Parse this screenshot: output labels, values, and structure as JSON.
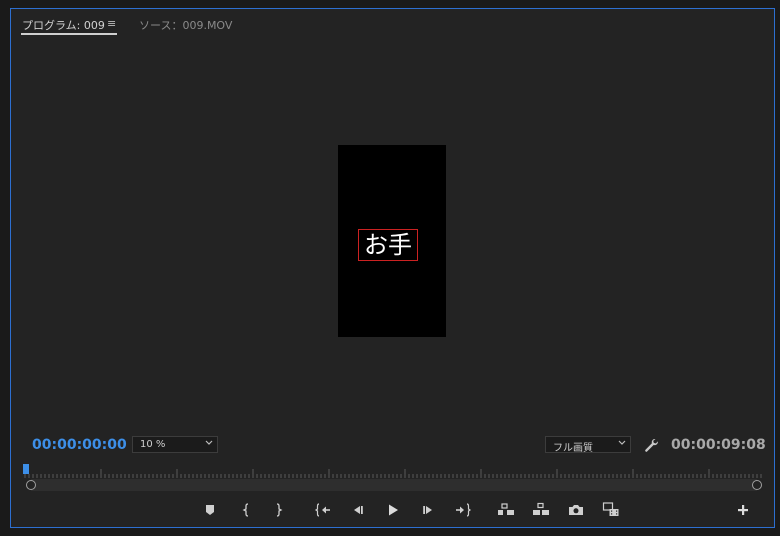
{
  "tabs": {
    "program": "プログラム: 009",
    "source": "ソース：009.MOV"
  },
  "viewer": {
    "caption": "お手"
  },
  "timecode": {
    "current": "00:00:00:00",
    "duration": "00:00:09:08"
  },
  "zoom": {
    "value": "10 %"
  },
  "quality": {
    "value": "フル画質"
  },
  "playhead": {
    "position": 0
  },
  "icons": [
    "menu-icon",
    "marker-icon",
    "mark-in-icon",
    "mark-out-icon",
    "go-to-in-icon",
    "step-back-icon",
    "play-icon",
    "step-forward-icon",
    "go-to-out-icon",
    "lift-icon",
    "extract-icon",
    "camera-icon",
    "compare-view-icon",
    "add-icon",
    "wrench-icon",
    "chevron-down-icon"
  ],
  "colors": {
    "accent": "#2d6fd0",
    "timecode_current": "#3d8fe8",
    "caption_border": "#cc2222"
  }
}
